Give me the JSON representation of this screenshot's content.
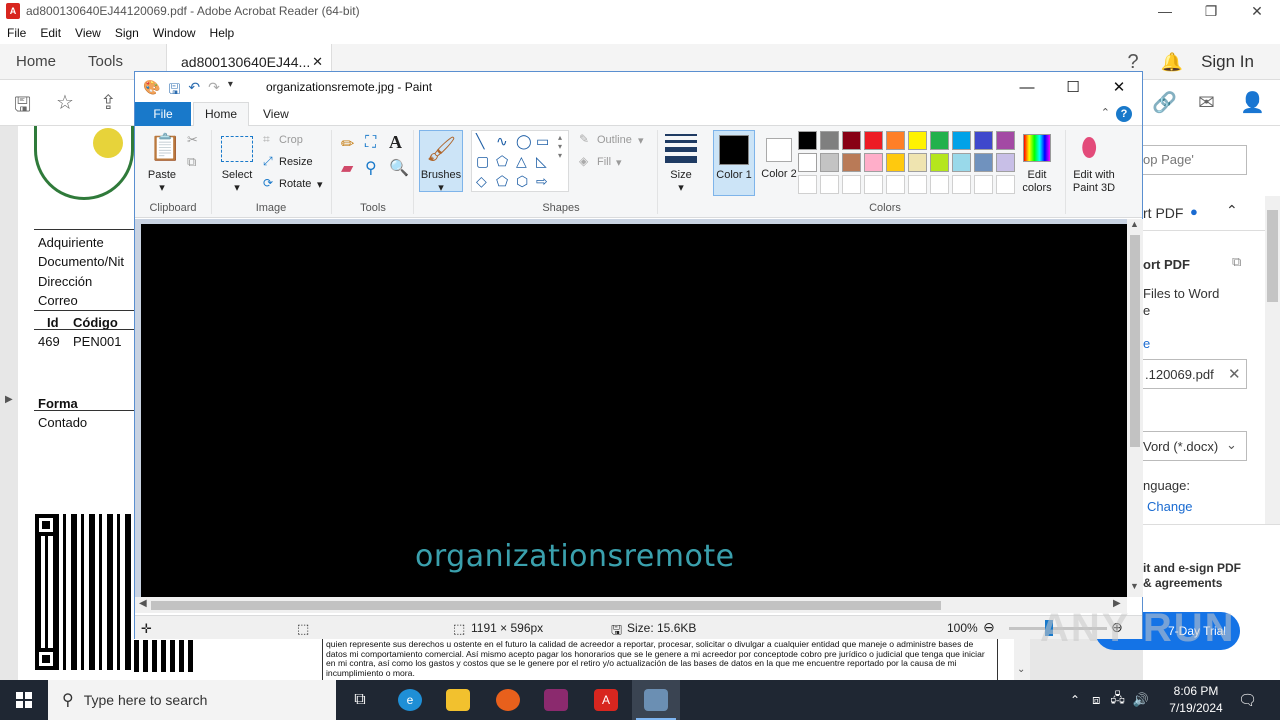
{
  "acrobat": {
    "title": "ad800130640EJ44120069.pdf - Adobe Acrobat Reader (64-bit)",
    "menu": [
      "File",
      "Edit",
      "View",
      "Sign",
      "Window",
      "Help"
    ],
    "tabs": {
      "home": "Home",
      "tools": "Tools",
      "doc": "ad800130640EJ44...",
      "doc_close": "✕"
    },
    "sign_in": "Sign In",
    "pdf": {
      "fields": [
        "Adquiriente",
        "Documento/Nit",
        "Dirección",
        "Correo"
      ],
      "col_id": "Id",
      "col_code": "Código",
      "row_id": "469",
      "row_code": "PEN001",
      "forma": "Forma",
      "contado": "Contado",
      "body_text": "quien represente sus derechos u ostente en el futuro la calidad de acreedor a reportar, procesar, solicitar o divulgar a cualquier entidad que maneje o administre bases de datos mi comportamiento comercial. Así mismo acepto pagar los honorarios que se le genere a mi acreedor por conceptode cobro pre jurídico o judicial que tenga que iniciar en mi contra, así como los gastos y costos que se le genere por el retiro y/o actualización de las bases de datos en la que me encuentre reportado por la causa de mi incumplimiento o mora."
    },
    "right_panel": {
      "search_placeholder": "op Page'",
      "export_header": "rt PDF",
      "export_title": "ort PDF",
      "desc_line1": "Files to Word",
      "desc_line2": "e",
      "link_e": "e",
      "file_name": ".120069.pdf",
      "format": "Vord (*.docx)",
      "language": "nguage:",
      "change": "Change",
      "promo_line1": "it and e-sign PDF",
      "promo_line2": "& agreements",
      "trial": "7-Day Trial"
    }
  },
  "paint": {
    "title": "organizationsremote.jpg - Paint",
    "tabs": {
      "file": "File",
      "home": "Home",
      "view": "View"
    },
    "ribbon": {
      "paste": "Paste",
      "clipboard": "Clipboard",
      "select": "Select",
      "crop": "Crop",
      "resize": "Resize",
      "rotate": "Rotate",
      "image": "Image",
      "tools": "Tools",
      "brushes": "Brushes",
      "outline": "Outline",
      "fill": "Fill",
      "shapes": "Shapes",
      "size": "Size",
      "color1": "Color 1",
      "color2": "Color 2",
      "colors": "Colors",
      "edit_colors": "Edit colors",
      "edit_paint3d": "Edit with Paint 3D"
    },
    "palette_row1": [
      "#000000",
      "#7f7f7f",
      "#880015",
      "#ed1c24",
      "#ff7f27",
      "#fff200",
      "#22b14c",
      "#00a2e8",
      "#3f48cc",
      "#a349a4"
    ],
    "palette_row2": [
      "#ffffff",
      "#c3c3c3",
      "#b97a57",
      "#ffaec9",
      "#ffc90e",
      "#efe4b0",
      "#b5e61d",
      "#99d9ea",
      "#7092be",
      "#c8bfe7"
    ],
    "canvas_text": "organizationsremote",
    "status": {
      "dimensions": "1191 × 596px",
      "size": "Size: 15.6KB",
      "zoom": "100%"
    }
  },
  "taskbar": {
    "search_placeholder": "Type here to search",
    "time": "8:06 PM",
    "date": "7/19/2024"
  },
  "watermark": "ANY RUN"
}
